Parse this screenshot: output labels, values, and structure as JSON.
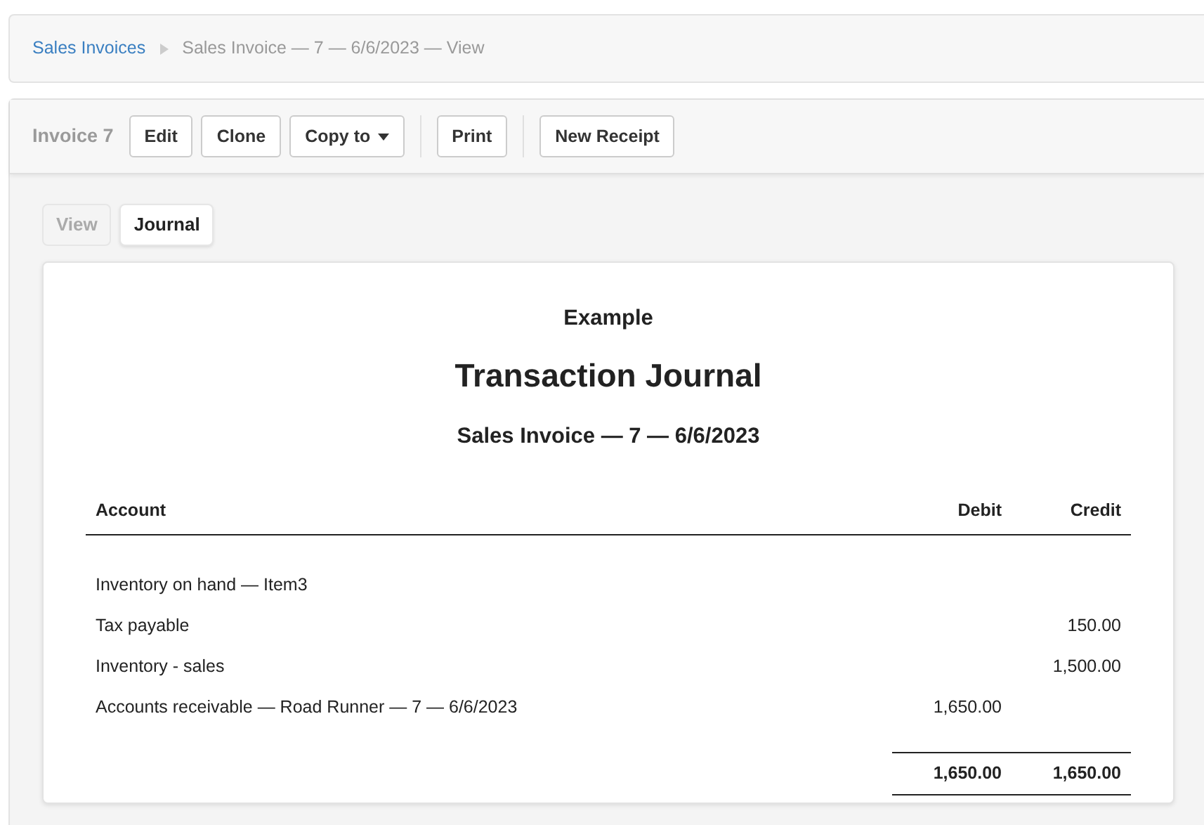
{
  "breadcrumb": [
    {
      "label": "Sales Invoices",
      "kind": "link"
    },
    {
      "label": "Sales Invoice — 7 — 6/6/2023 — View",
      "kind": "current"
    }
  ],
  "toolbar": {
    "title": "Invoice 7",
    "button_groups": [
      [
        {
          "label": "Edit",
          "kind": "plain"
        },
        {
          "label": "Clone",
          "kind": "plain"
        },
        {
          "label": "Copy to",
          "kind": "dropdown"
        }
      ],
      [
        {
          "label": "Print",
          "kind": "plain"
        }
      ],
      [
        {
          "label": "New Receipt",
          "kind": "plain"
        }
      ]
    ]
  },
  "tabs": [
    {
      "label": "View",
      "selected": false
    },
    {
      "label": "Journal",
      "selected": true
    }
  ],
  "report": {
    "company": "Example",
    "title": "Transaction Journal",
    "subtitle": "Sales Invoice — 7 — 6/6/2023",
    "columns": [
      "Account",
      "Debit",
      "Credit"
    ],
    "rows": [
      {
        "account": "Inventory on hand — Item3"
      },
      {
        "account": "Tax payable",
        "credit": "150.00"
      },
      {
        "account": "Inventory - sales",
        "credit": "1,500.00"
      },
      {
        "account": "Accounts receivable — Road Runner — 7 — 6/6/2023",
        "debit": "1,650.00"
      }
    ],
    "totals": {
      "debit": "1,650.00",
      "credit": "1,650.00"
    }
  }
}
